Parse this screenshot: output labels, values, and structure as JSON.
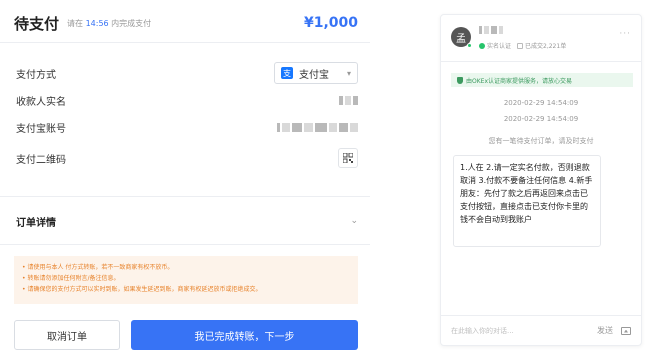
{
  "header": {
    "title": "待支付",
    "tip_prefix": "请在",
    "tip_time": "14:56",
    "tip_suffix": "内完成支付",
    "amount": "¥1,000"
  },
  "fields": {
    "method_label": "支付方式",
    "method_value": "支付宝",
    "method_icon": "支",
    "payee_label": "收款人实名",
    "account_label": "支付宝账号",
    "qr_label": "支付二维码"
  },
  "order_detail_label": "订单详情",
  "notice": [
    "• 请使用与本人          付方式转账，若不一致商家有权不放币。",
    "• 转账请勿添加任何附言/备注信息。",
    "• 请确保您的支付方式可以实时到账，如果发生延迟到账，商家有权延迟放币或拒绝成交。"
  ],
  "buttons": {
    "cancel": "取消订单",
    "done": "我已完成转账，下一步"
  },
  "chat": {
    "avatar_initial": "孟",
    "verified_label": "实名认证",
    "trades_label": "已成交2,221单",
    "more": "···",
    "secure_text": "由OKEx认证商家提供服务，请放心交易",
    "timestamp1": "2020-02-29 14:54:09",
    "timestamp2": "2020-02-29 14:54:09",
    "system_msg": "您有一笔待支付订单，请及时支付",
    "message": "1.人在 2.请一定实名付款，否则退款取消 3.付款不要备注任何信息 4.新手朋友：先付了款之后再返回来点击已支付按钮，直接点击已支付你卡里的钱不会自动到我账户",
    "input_placeholder": "在此输入你的对话...",
    "send_label": "发送"
  },
  "colors": {
    "accent": "#3773f5",
    "notice_bg": "#fdf3ea",
    "notice_text": "#e7822b",
    "secure_bg": "#eaf7ee",
    "secure_text": "#3c9a5f"
  },
  "icons": {
    "method_icon": "alipay-icon",
    "qr_icon": "qr-code-icon",
    "chevron": "chevron-down-icon",
    "more": "more-icon",
    "shield": "shield-icon",
    "image": "image-icon"
  }
}
